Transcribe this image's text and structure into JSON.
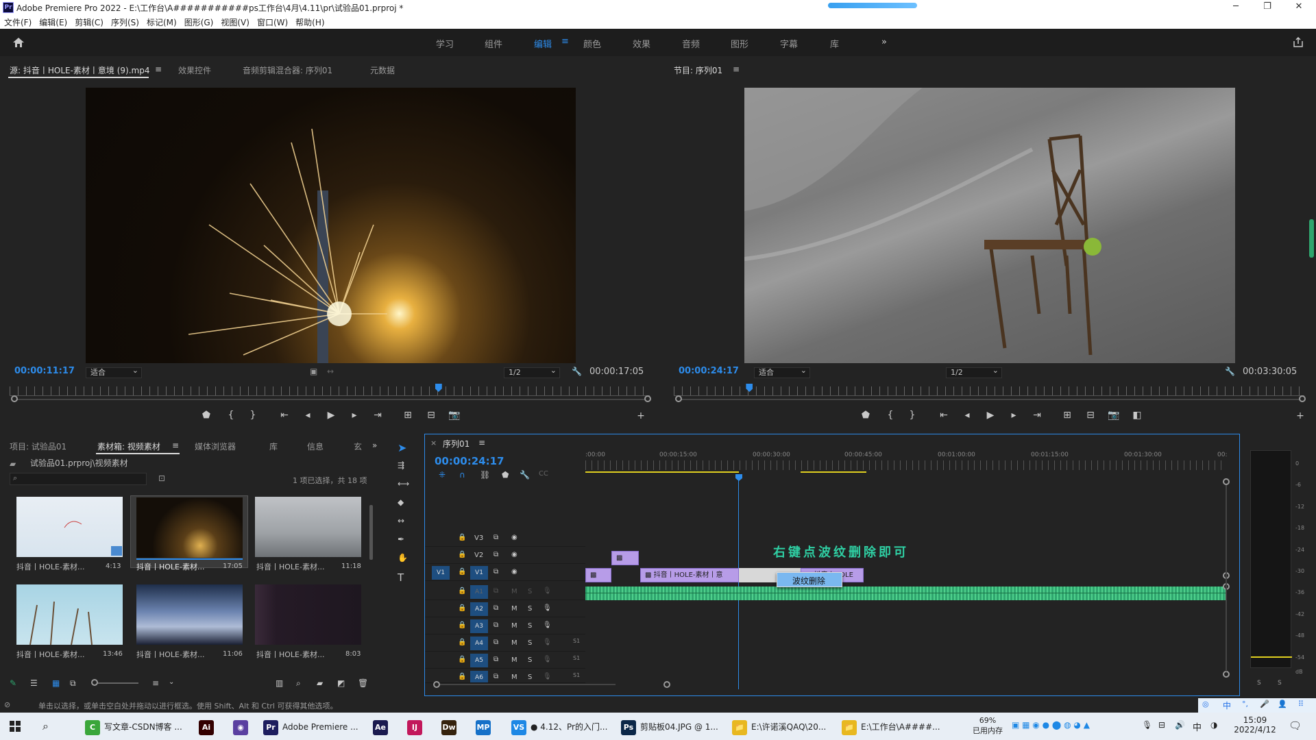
{
  "window": {
    "app_badge": "Pr",
    "title": "Adobe Premiere Pro 2022 - E:\\工作台\\A###########ps工作台\\4月\\4.11\\pr\\试验品01.prproj *",
    "min": "─",
    "max": "❐",
    "close": "✕"
  },
  "menu": [
    "文件(F)",
    "编辑(E)",
    "剪辑(C)",
    "序列(S)",
    "标记(M)",
    "图形(G)",
    "视图(V)",
    "窗口(W)",
    "帮助(H)"
  ],
  "workspaces": [
    "学习",
    "组件",
    "编辑",
    "颜色",
    "效果",
    "音频",
    "图形",
    "字幕",
    "库"
  ],
  "active_workspace": "编辑",
  "source": {
    "tabs": [
      "源: 抖音丨HOLE-素材丨意境 (9).mp4",
      "效果控件",
      "音频剪辑混合器: 序列01",
      "元数据"
    ],
    "timecode": "00:00:11:17",
    "fit": "适合",
    "resolution": "1/2",
    "duration": "00:00:17:05",
    "playhead_fraction": 0.67
  },
  "program": {
    "tab": "节目: 序列01",
    "timecode": "00:00:24:17",
    "fit": "适合",
    "resolution": "1/2",
    "duration": "00:03:30:05",
    "playhead_fraction": 0.12
  },
  "project": {
    "tabs": [
      "项目: 试验品01",
      "素材箱: 视频素材",
      "媒体浏览器",
      "库",
      "信息",
      "玄"
    ],
    "path": "试验品01.prproj\\视频素材",
    "selection_info": "1 项已选择，共 18 项",
    "items": [
      {
        "name": "抖音丨HOLE-素材...",
        "duration": "4:13"
      },
      {
        "name": "抖音丨HOLE-素材...",
        "duration": "17:05"
      },
      {
        "name": "抖音丨HOLE-素材...",
        "duration": "11:18"
      },
      {
        "name": "抖音丨HOLE-素材...",
        "duration": "13:46"
      },
      {
        "name": "抖音丨HOLE-素材...",
        "duration": "11:06"
      },
      {
        "name": "抖音丨HOLE-素材...",
        "duration": "8:03"
      }
    ]
  },
  "timeline": {
    "tab": "序列01",
    "timecode": "00:00:24:17",
    "ruler_labels": [
      ":00:00",
      "00:00:15:00",
      "00:00:30:00",
      "00:00:45:00",
      "00:01:00:00",
      "00:01:15:00",
      "00:01:30:00",
      "00:"
    ],
    "video_tracks": [
      "V3",
      "V2",
      "V1"
    ],
    "audio_tracks": [
      "A1",
      "A2",
      "A3",
      "A4",
      "A5",
      "A6"
    ],
    "source_patch": "V1",
    "m_label": "M",
    "s_label": "S",
    "clip1_label": "抖音丨HOLE-素材丨意",
    "clip2_label": "抖音丨HOLE",
    "annotation": "右键点波纹删除即可",
    "context_menu_item": "波纹删除",
    "audio_channel_label": "S1"
  },
  "meter": {
    "scale": [
      "0",
      "-6",
      "-12",
      "-18",
      "-24",
      "-30",
      "-36",
      "-42",
      "-48",
      "-54",
      "dB"
    ],
    "solo_labels": [
      "S",
      "S"
    ]
  },
  "status": {
    "text": "单击以选择，或单击空白处并拖动以进行框选。使用 Shift、Alt 和 Ctrl 可获得其他选项。"
  },
  "ime": [
    "中",
    "°,",
    "🎤",
    "👤",
    "⠿"
  ],
  "taskbar": {
    "items": [
      {
        "label": "写文章-CSDN博客 ...",
        "icon": "C",
        "color": "#3aa63a"
      },
      {
        "label": "",
        "icon": "Ai",
        "color": "#330000"
      },
      {
        "label": "",
        "icon": "◉",
        "color": "#5a3fa0"
      },
      {
        "label": "Adobe Premiere ...",
        "icon": "Pr",
        "color": "#1d1d5e"
      },
      {
        "label": "",
        "icon": "Ae",
        "color": "#1a1a4f"
      },
      {
        "label": "",
        "icon": "IJ",
        "color": "#c2185b"
      },
      {
        "label": "",
        "icon": "Dw",
        "color": "#35220d"
      },
      {
        "label": "",
        "icon": "MP",
        "color": "#1570c8"
      },
      {
        "label": "● 4.12、Pr的入门...",
        "icon": "VS",
        "color": "#1e88e5"
      },
      {
        "label": "剪贴板04.JPG @ 1...",
        "icon": "Ps",
        "color": "#0b2748"
      },
      {
        "label": "E:\\许诺溪QAQ\\20...",
        "icon": "📁",
        "color": "#e8b820"
      },
      {
        "label": "E:\\工作台\\A####...",
        "icon": "📁",
        "color": "#e8b820"
      }
    ],
    "memory_percent": "69%",
    "memory_label": "已用内存",
    "ime_mode": "中",
    "time": "15:09",
    "date": "2022/4/12"
  }
}
